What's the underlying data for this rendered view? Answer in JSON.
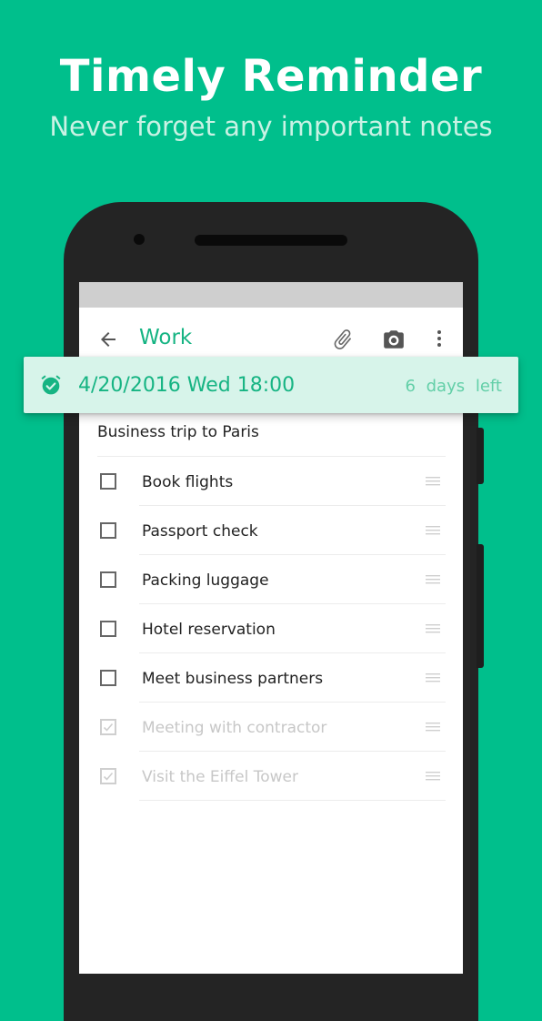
{
  "promo": {
    "headline": "Timely Reminder",
    "subline": "Never forget any important notes"
  },
  "colors": {
    "background": "#00BF8C",
    "accent": "#16B483",
    "reminder_bg": "#D7F4EA",
    "phone_body": "#242424"
  },
  "toolbar": {
    "back_icon": "arrow-left-icon",
    "title": "Work",
    "attach_icon": "paperclip-icon",
    "camera_icon": "camera-icon",
    "more_icon": "more-vert-icon"
  },
  "reminder": {
    "icon": "alarm-check-icon",
    "datetime": "4/20/2016 Wed 18:00",
    "remaining": "6 days left"
  },
  "note": {
    "title": "Business trip to Paris",
    "items": [
      {
        "label": "Book flights",
        "checked": false
      },
      {
        "label": "Passport check",
        "checked": false
      },
      {
        "label": "Packing luggage",
        "checked": false
      },
      {
        "label": "Hotel reservation",
        "checked": false
      },
      {
        "label": "Meet business partners",
        "checked": false
      },
      {
        "label": "Meeting with contractor",
        "checked": true
      },
      {
        "label": "Visit the Eiffel Tower",
        "checked": true
      }
    ],
    "drag_icon": "drag-handle-icon"
  }
}
